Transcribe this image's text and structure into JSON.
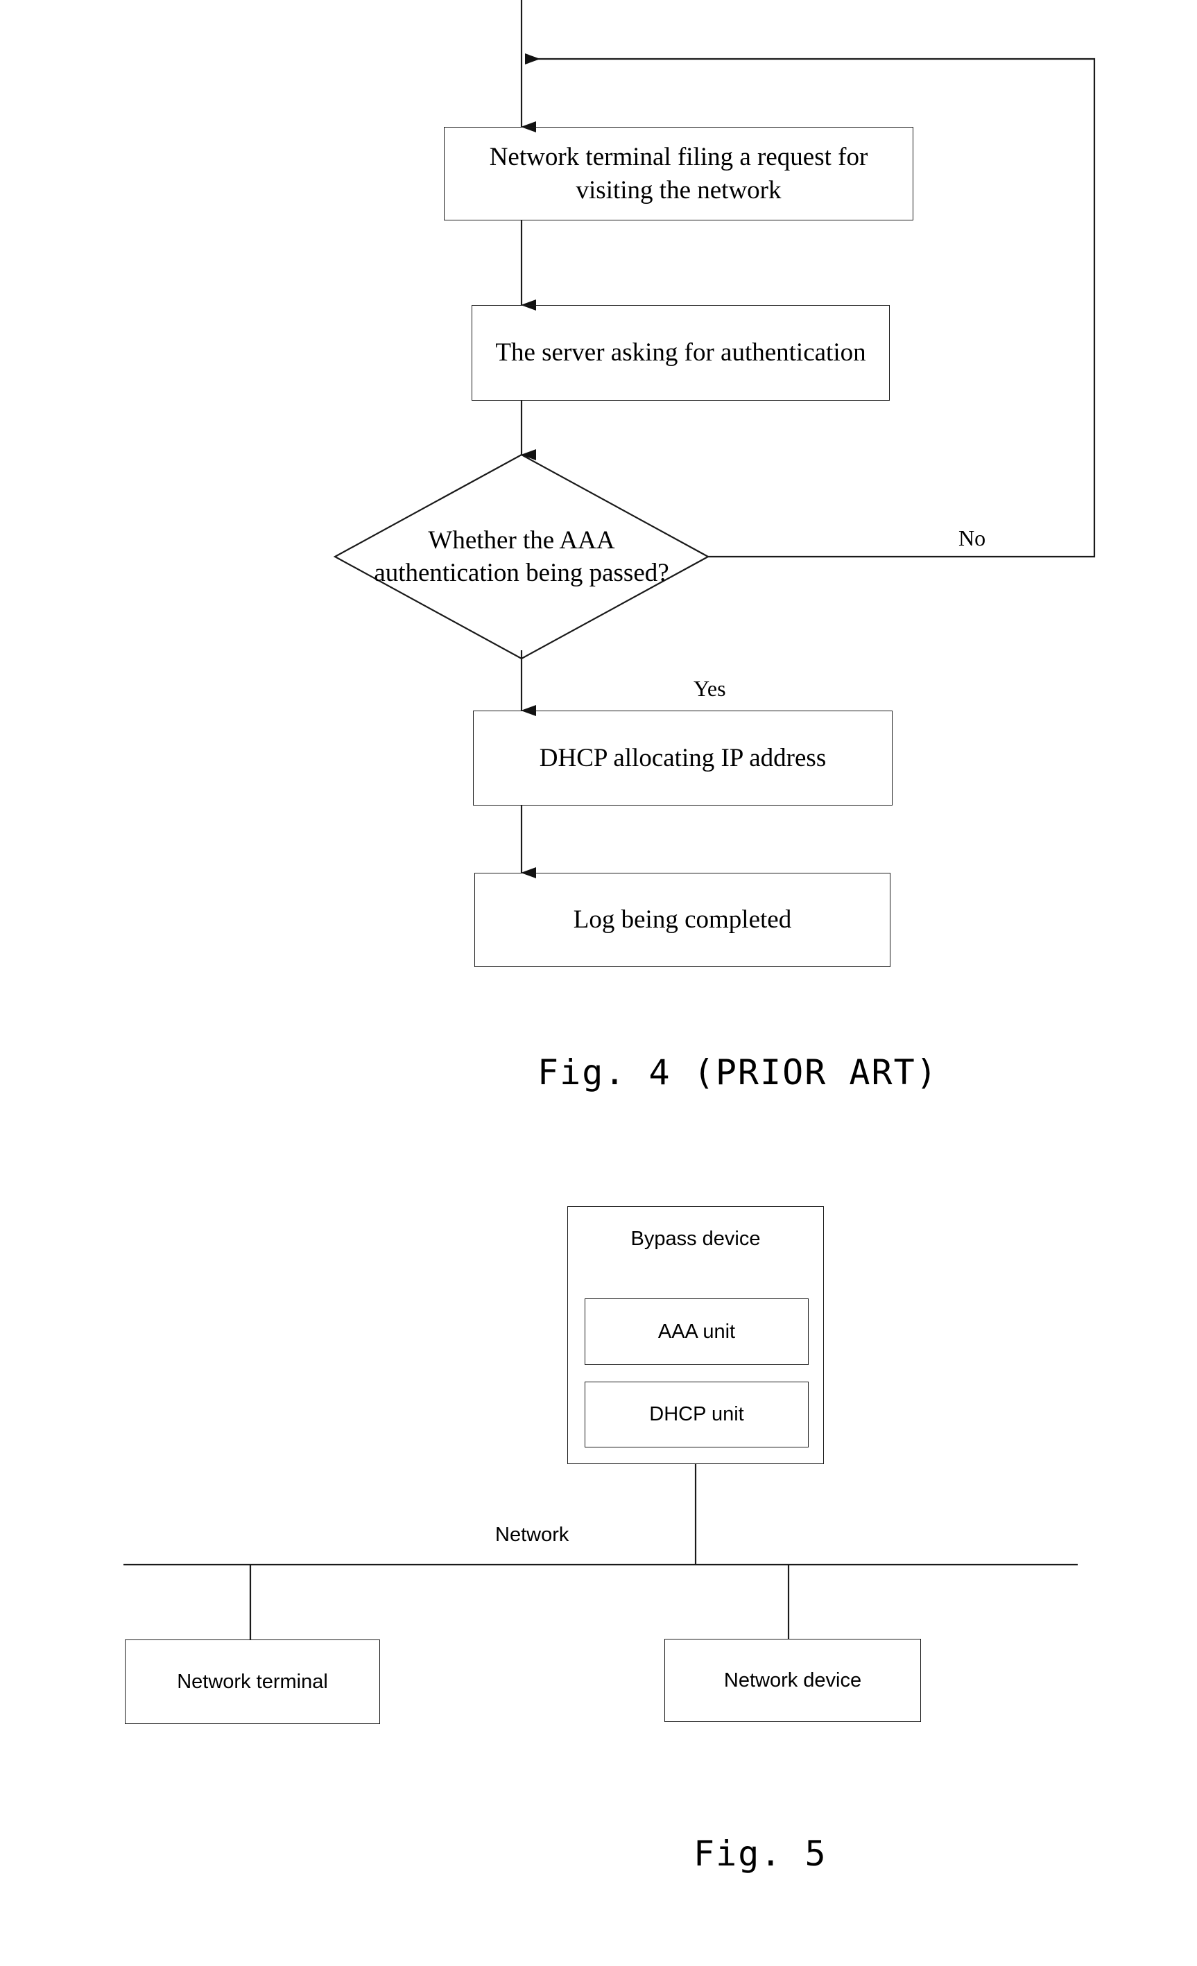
{
  "document": {
    "type": "patent-drawing-sheet",
    "figures": [
      "Fig. 4 (PRIOR ART)",
      "Fig. 5"
    ]
  },
  "fig4": {
    "caption": "Fig. 4  (PRIOR ART)",
    "nodes": [
      {
        "id": "n1",
        "shape": "rect",
        "label": "Network terminal filing a request for visiting the network"
      },
      {
        "id": "n2",
        "shape": "rect",
        "label": "The server asking for authentication"
      },
      {
        "id": "n3",
        "shape": "diamond",
        "label_line1": "Whether the AAA",
        "label_line2": "authentication being passed?"
      },
      {
        "id": "n4",
        "shape": "rect",
        "label": "DHCP allocating IP address"
      },
      {
        "id": "n5",
        "shape": "rect",
        "label": "Log being completed"
      }
    ],
    "edge_labels": {
      "no": "No",
      "yes": "Yes"
    },
    "edges": [
      {
        "from": "entry",
        "to": "n1",
        "label": ""
      },
      {
        "from": "n1",
        "to": "n2",
        "label": ""
      },
      {
        "from": "n2",
        "to": "n3",
        "label": ""
      },
      {
        "from": "n3",
        "to": "n4",
        "label": "Yes"
      },
      {
        "from": "n3",
        "to": "entry",
        "label": "No"
      },
      {
        "from": "n4",
        "to": "n5",
        "label": ""
      }
    ]
  },
  "fig5": {
    "caption": "Fig. 5",
    "bus_label": "Network",
    "bypass": {
      "title": "Bypass device",
      "units": [
        {
          "label": "AAA unit"
        },
        {
          "label": "DHCP unit"
        }
      ]
    },
    "endpoints": [
      {
        "label": "Network terminal"
      },
      {
        "label": "Network device"
      }
    ]
  }
}
